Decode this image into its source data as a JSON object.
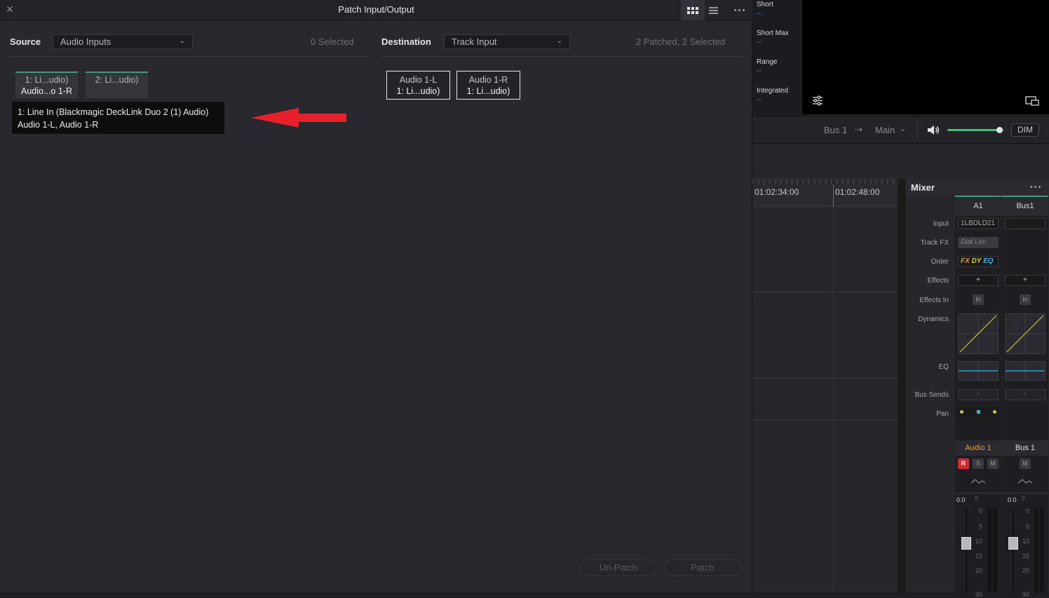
{
  "dialog": {
    "title": "Patch Input/Output",
    "close_glyph": "✕"
  },
  "source": {
    "label": "Source",
    "dropdown_value": "Audio Inputs",
    "selected_count": "0 Selected",
    "tiles": [
      {
        "line1": "1: Li...udio)",
        "line2": "Audio...o 1-R"
      },
      {
        "line1": "2: Li...udio)",
        "line2": ""
      }
    ]
  },
  "destination": {
    "label": "Destination",
    "dropdown_value": "Track Input",
    "status": "2 Patched, 2 Selected",
    "tiles": [
      {
        "line1": "Audio 1-L",
        "line2": "1: Li...udio)"
      },
      {
        "line1": "Audio 1-R",
        "line2": "1: Li...udio)"
      }
    ]
  },
  "tooltip": {
    "line1": "1: Line In (Blackmagic DeckLink Duo 2 (1) Audio)",
    "line2": "Audio 1-L, Audio 1-R"
  },
  "footer": {
    "unpatch_label": "Un-Patch",
    "patch_label": "Patch"
  },
  "loudness": {
    "short_label": "Short",
    "short_value": "--",
    "short_max_label": "Short Max",
    "short_max_value": "--",
    "range_label": "Range",
    "range_value": "--",
    "integrated_label": "Integrated",
    "integrated_value": "--"
  },
  "transport": {
    "bus": "Bus 1",
    "output": "Main",
    "dim_label": "DIM",
    "volume_level": 0.9
  },
  "timeline": {
    "timecodes": [
      "01:02:34:00",
      "01:02:48:00"
    ]
  },
  "mixer": {
    "title": "Mixer",
    "row_labels": [
      "Input",
      "Track FX",
      "Order",
      "Effects",
      "Effects In",
      "Dynamics",
      "EQ",
      "Bus Sends",
      "Pan"
    ],
    "channels": [
      {
        "header": "A1",
        "input": "1LBDLD21",
        "track_fx": "Dial Lev",
        "order": [
          "FX",
          "DY",
          "EQ"
        ],
        "effects": "+",
        "effects_in": "In",
        "bus_sends": "+",
        "name": "Audio 1",
        "buttons": [
          "R",
          "S",
          "M"
        ],
        "fader_value": "0.0"
      },
      {
        "header": "Bus1",
        "input": "",
        "effects": "+",
        "effects_in": "In",
        "bus_sends": "+",
        "name": "Bus 1",
        "buttons": [
          "M"
        ],
        "fader_value": "0.0"
      }
    ],
    "scale": [
      "0",
      "5",
      "10",
      "15",
      "20",
      "30"
    ]
  },
  "colors": {
    "accent_green": "#3e9a7a",
    "arrow_red": "#e8202a",
    "record_red": "#d9262c",
    "name_orange": "#e0a030"
  }
}
